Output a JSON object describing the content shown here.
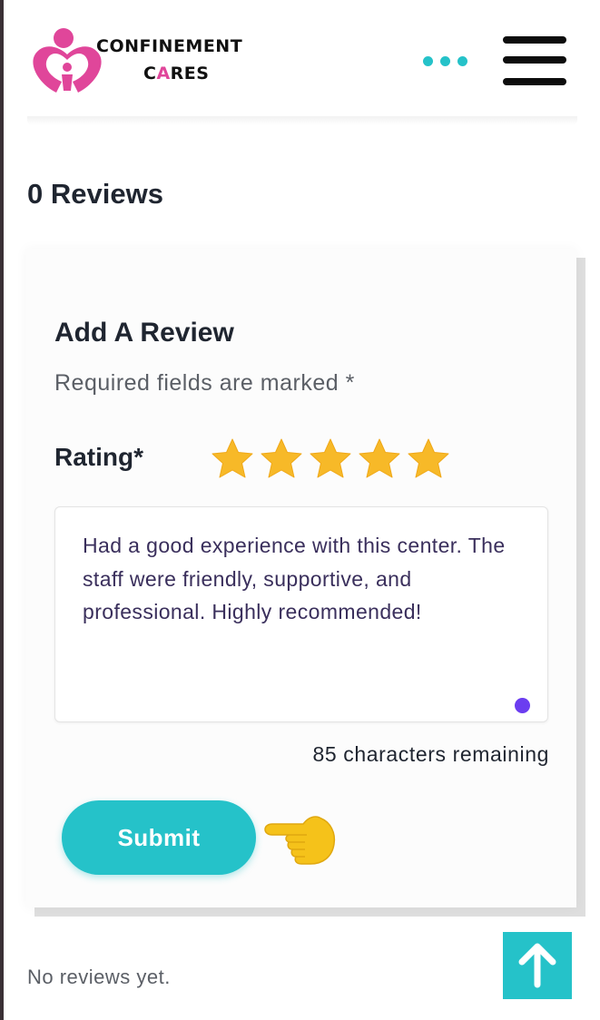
{
  "brand": {
    "name_line1": "CONFINEMENT",
    "name_line2_prefix": "C",
    "name_line2_accent": "A",
    "name_line2_suffix": "RES",
    "primary_color": "#25c2c9",
    "logo_color": "#e0469a"
  },
  "header": {
    "more_icon": "ellipsis-icon",
    "menu_icon": "hamburger-menu-icon"
  },
  "reviews": {
    "count_label": "0 Reviews",
    "empty_message": "No reviews yet."
  },
  "review_form": {
    "title": "Add A Review",
    "required_note": "Required fields are marked *",
    "rating_label": "Rating*",
    "rating_value": 5,
    "rating_max": 5,
    "review_text": "Had a good experience with this center. The staff were friendly, supportive, and professional. Highly recommended!",
    "chars_remaining": "85 characters remaining",
    "submit_label": "Submit"
  },
  "back_to_top": {
    "icon": "arrow-up-icon"
  }
}
